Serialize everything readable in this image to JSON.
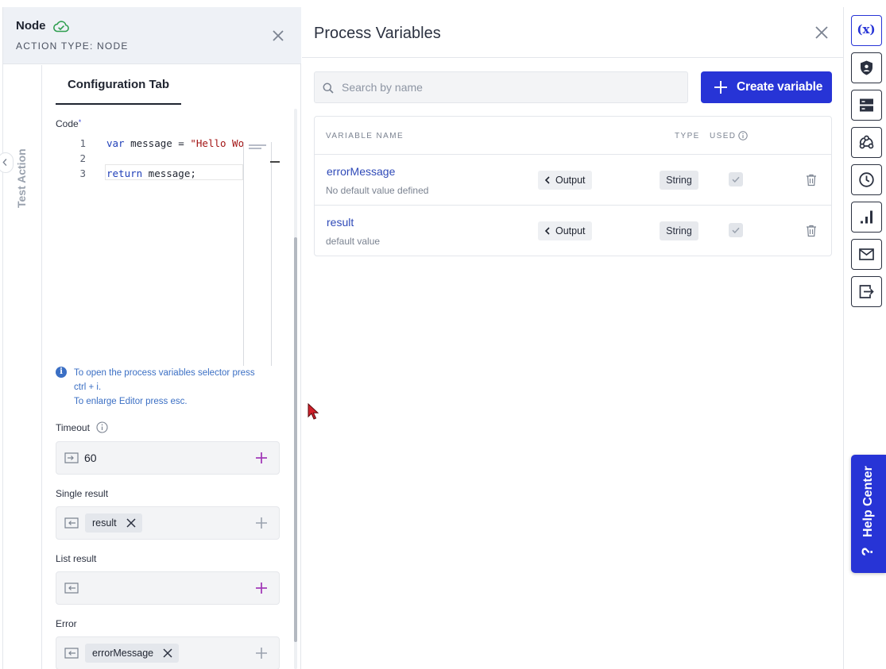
{
  "node_panel": {
    "title": "Node",
    "subtitle": "ACTION TYPE: NODE",
    "side_tab": "Test Action",
    "active_tab": "Configuration Tab"
  },
  "code_field": {
    "label": "Code",
    "required_mark": "*",
    "lines": [
      {
        "no": "1",
        "kw": "var",
        "text": " message = ",
        "str": "\"Hello Wo"
      },
      {
        "no": "2",
        "kw": "",
        "text": "",
        "str": ""
      },
      {
        "no": "3",
        "kw": "return",
        "text": " message;",
        "str": ""
      }
    ]
  },
  "info_hint": {
    "line1": "To open the process variables selector press",
    "line2": "ctrl + i.",
    "line3": "To enlarge Editor press esc."
  },
  "timeout": {
    "label": "Timeout",
    "value": "60"
  },
  "single_result": {
    "label": "Single result",
    "chip": "result"
  },
  "list_result": {
    "label": "List result"
  },
  "error_field": {
    "label": "Error",
    "chip": "errorMessage"
  },
  "process_variables": {
    "title": "Process Variables",
    "search_placeholder": "Search by name",
    "create_button": "Create variable",
    "columns": {
      "name": "VARIABLE NAME",
      "type": "TYPE",
      "used": "USED"
    },
    "rows": [
      {
        "name": "errorMessage",
        "default": "No default value defined",
        "direction": "Output",
        "type": "String",
        "used": true
      },
      {
        "name": "result",
        "default": "default value",
        "direction": "Output",
        "type": "String",
        "used": true
      }
    ]
  },
  "right_rail": {
    "variables_glyph": "(x)",
    "icons": [
      "variables-icon",
      "shield-icon",
      "server-icon",
      "webhook-icon",
      "clock-icon",
      "analytics-icon",
      "mail-icon",
      "export-icon"
    ]
  },
  "help_center": {
    "label": "Help Center",
    "glyph": "?"
  },
  "colors": {
    "accent": "#2734d6",
    "link": "#2f4ab8",
    "success": "#2e9e4f",
    "add": "#a33bb8"
  }
}
